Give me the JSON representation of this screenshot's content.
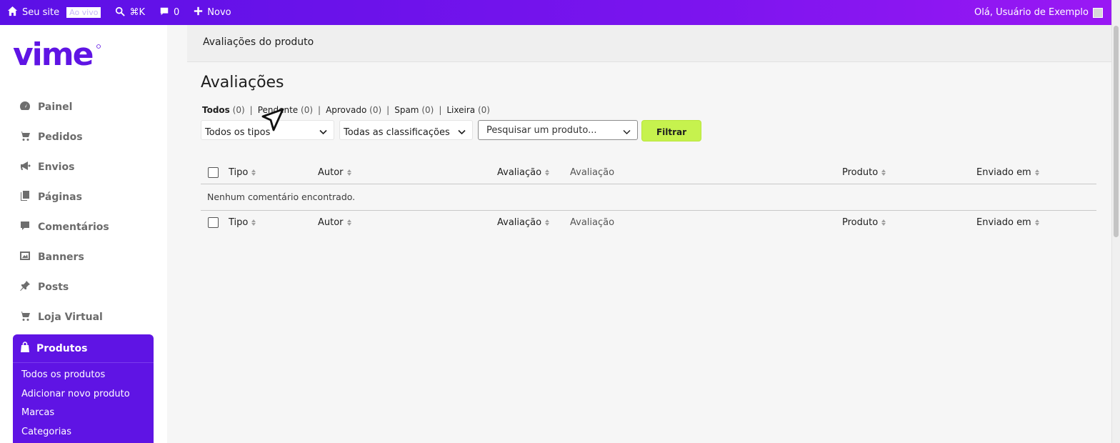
{
  "adminbar": {
    "site_label": "Seu site",
    "live_badge": "Ao vivo",
    "search_shortcut": "⌘K",
    "comments_count": "0",
    "new_label": "Novo",
    "greeting": "Olá, Usuário de Exemplo"
  },
  "brand": {
    "logo_text": "vime",
    "accent": "#5f14e4",
    "filter_button_color": "#c6f24e"
  },
  "sidebar": {
    "items": [
      {
        "label": "Painel",
        "icon": "gauge-icon"
      },
      {
        "label": "Pedidos",
        "icon": "cart-icon"
      },
      {
        "label": "Envios",
        "icon": "megaphone-icon"
      },
      {
        "label": "Páginas",
        "icon": "pages-icon"
      },
      {
        "label": "Comentários",
        "icon": "comment-icon"
      },
      {
        "label": "Banners",
        "icon": "image-icon"
      },
      {
        "label": "Posts",
        "icon": "pin-icon"
      },
      {
        "label": "Loja Virtual",
        "icon": "cart-icon"
      }
    ],
    "active": {
      "label": "Produtos",
      "icon": "bag-icon",
      "submenu": [
        "Todos os produtos",
        "Adicionar novo produto",
        "Marcas",
        "Categorias"
      ]
    }
  },
  "main": {
    "header_title": "Avaliações do produto",
    "page_title": "Avaliações",
    "status_links": [
      {
        "label": "Todos",
        "count": "(0)"
      },
      {
        "label": "Pendente",
        "count": "(0)"
      },
      {
        "label": "Aprovado",
        "count": "(0)"
      },
      {
        "label": "Spam",
        "count": "(0)"
      },
      {
        "label": "Lixeira",
        "count": "(0)"
      }
    ],
    "separator": "|",
    "filters": {
      "type_select": "Todos os tipos",
      "rating_select": "Todas as classificações",
      "product_search": "Pesquisar um produto...",
      "filter_button": "Filtrar"
    },
    "table": {
      "columns": [
        "Tipo",
        "Autor",
        "Avaliação",
        "Avaliação",
        "Produto",
        "Enviado em"
      ],
      "empty_message": "Nenhum comentário encontrado."
    }
  }
}
